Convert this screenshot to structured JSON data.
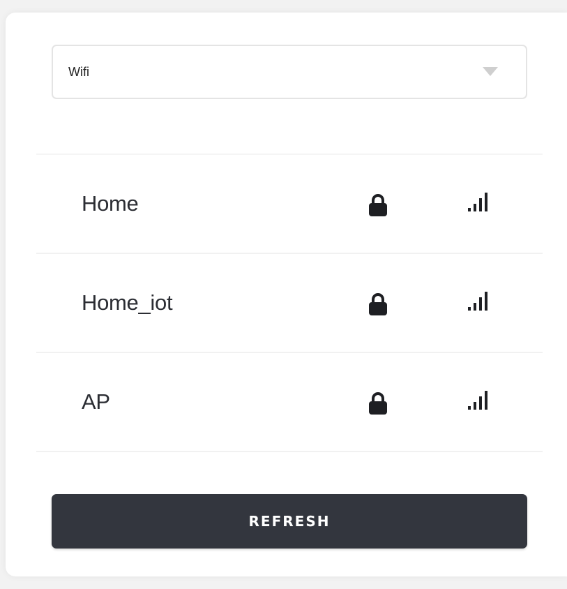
{
  "network_type_select": {
    "value": "Wifi"
  },
  "networks": [
    {
      "ssid": "Home",
      "secured": true,
      "signal": "strong"
    },
    {
      "ssid": "Home_iot",
      "secured": true,
      "signal": "strong"
    },
    {
      "ssid": "AP",
      "secured": true,
      "signal": "strong"
    }
  ],
  "actions": {
    "refresh_label": "REFRESH"
  },
  "icons": {
    "dropdown": "chevron-down-icon",
    "lock": "lock-icon",
    "signal": "signal-strength-icon"
  },
  "colors": {
    "button_background": "#33363e",
    "button_text": "#ffffff",
    "text_primary": "#2b2d33",
    "icon": "#1e1f23"
  }
}
